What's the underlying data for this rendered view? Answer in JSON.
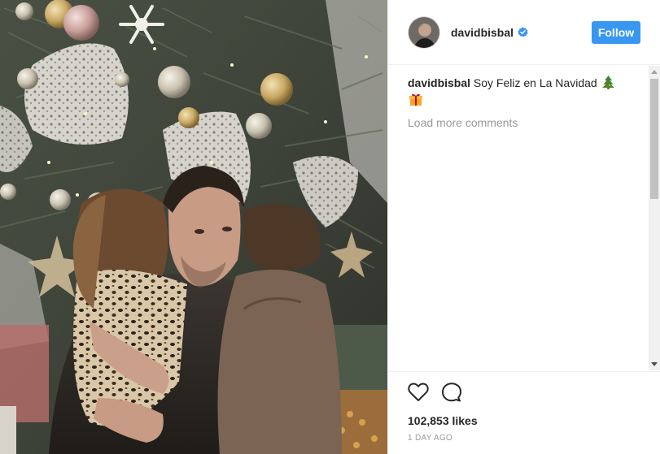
{
  "post": {
    "username": "davidbisbal",
    "verified": true,
    "follow_label": "Follow",
    "caption_user": "davidbisbal",
    "caption_text": "Soy Feliz en La Navidad",
    "caption_emojis": [
      "christmas-tree-emoji",
      "wrapped-gift-emoji"
    ],
    "load_more_label": "Load more comments",
    "likes": "102,853 likes",
    "timestamp": "1 DAY AGO"
  },
  "icons": {
    "like": "heart-outline-icon",
    "comment": "speech-bubble-icon",
    "verified": "verified-badge-icon"
  },
  "colors": {
    "follow_button": "#3897f0",
    "verified_badge": "#3897f0",
    "muted_text": "#999999",
    "primary_text": "#262626",
    "divider": "#efefef"
  }
}
